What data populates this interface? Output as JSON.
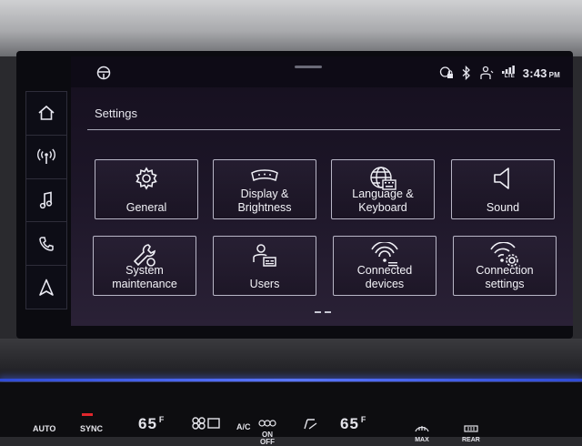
{
  "status": {
    "time": "3:43",
    "ampm": "PM",
    "lte": "LTE"
  },
  "sidebar": {
    "items": [
      {
        "name": "home",
        "icon": "home-icon"
      },
      {
        "name": "media",
        "icon": "radio-antenna-icon"
      },
      {
        "name": "music",
        "icon": "music-note-icon"
      },
      {
        "name": "phone",
        "icon": "phone-icon"
      },
      {
        "name": "navigation",
        "icon": "navigation-arrow-icon"
      }
    ]
  },
  "page": {
    "title": "Settings"
  },
  "tiles": [
    {
      "id": "general",
      "icon": "gear-icon",
      "label": "General"
    },
    {
      "id": "display",
      "icon": "display-icon",
      "label": "Display &\nBrightness"
    },
    {
      "id": "language",
      "icon": "globe-keyboard-icon",
      "label": "Language &\nKeyboard"
    },
    {
      "id": "sound",
      "icon": "speaker-icon",
      "label": "Sound"
    },
    {
      "id": "system",
      "icon": "wrench-icon",
      "label": "System\nmaintenance"
    },
    {
      "id": "users",
      "icon": "user-card-icon",
      "label": "Users"
    },
    {
      "id": "connected",
      "icon": "wifi-devices-icon",
      "label": "Connected\ndevices"
    },
    {
      "id": "connection",
      "icon": "wifi-gear-icon",
      "label": "Connection\nsettings"
    }
  ],
  "climate": {
    "auto": "AUTO",
    "sync": "SYNC",
    "temp_left": "65",
    "temp_right": "65",
    "unit": "F",
    "ac": "A/C",
    "on": "ON",
    "off": "OFF",
    "max": "MAX",
    "rear": "REAR"
  },
  "colors": {
    "screen_bg": "#1d1628",
    "tile_border": "#b8b6c6",
    "ambient_light": "#5a76ff",
    "sync_led": "#e0262c"
  }
}
